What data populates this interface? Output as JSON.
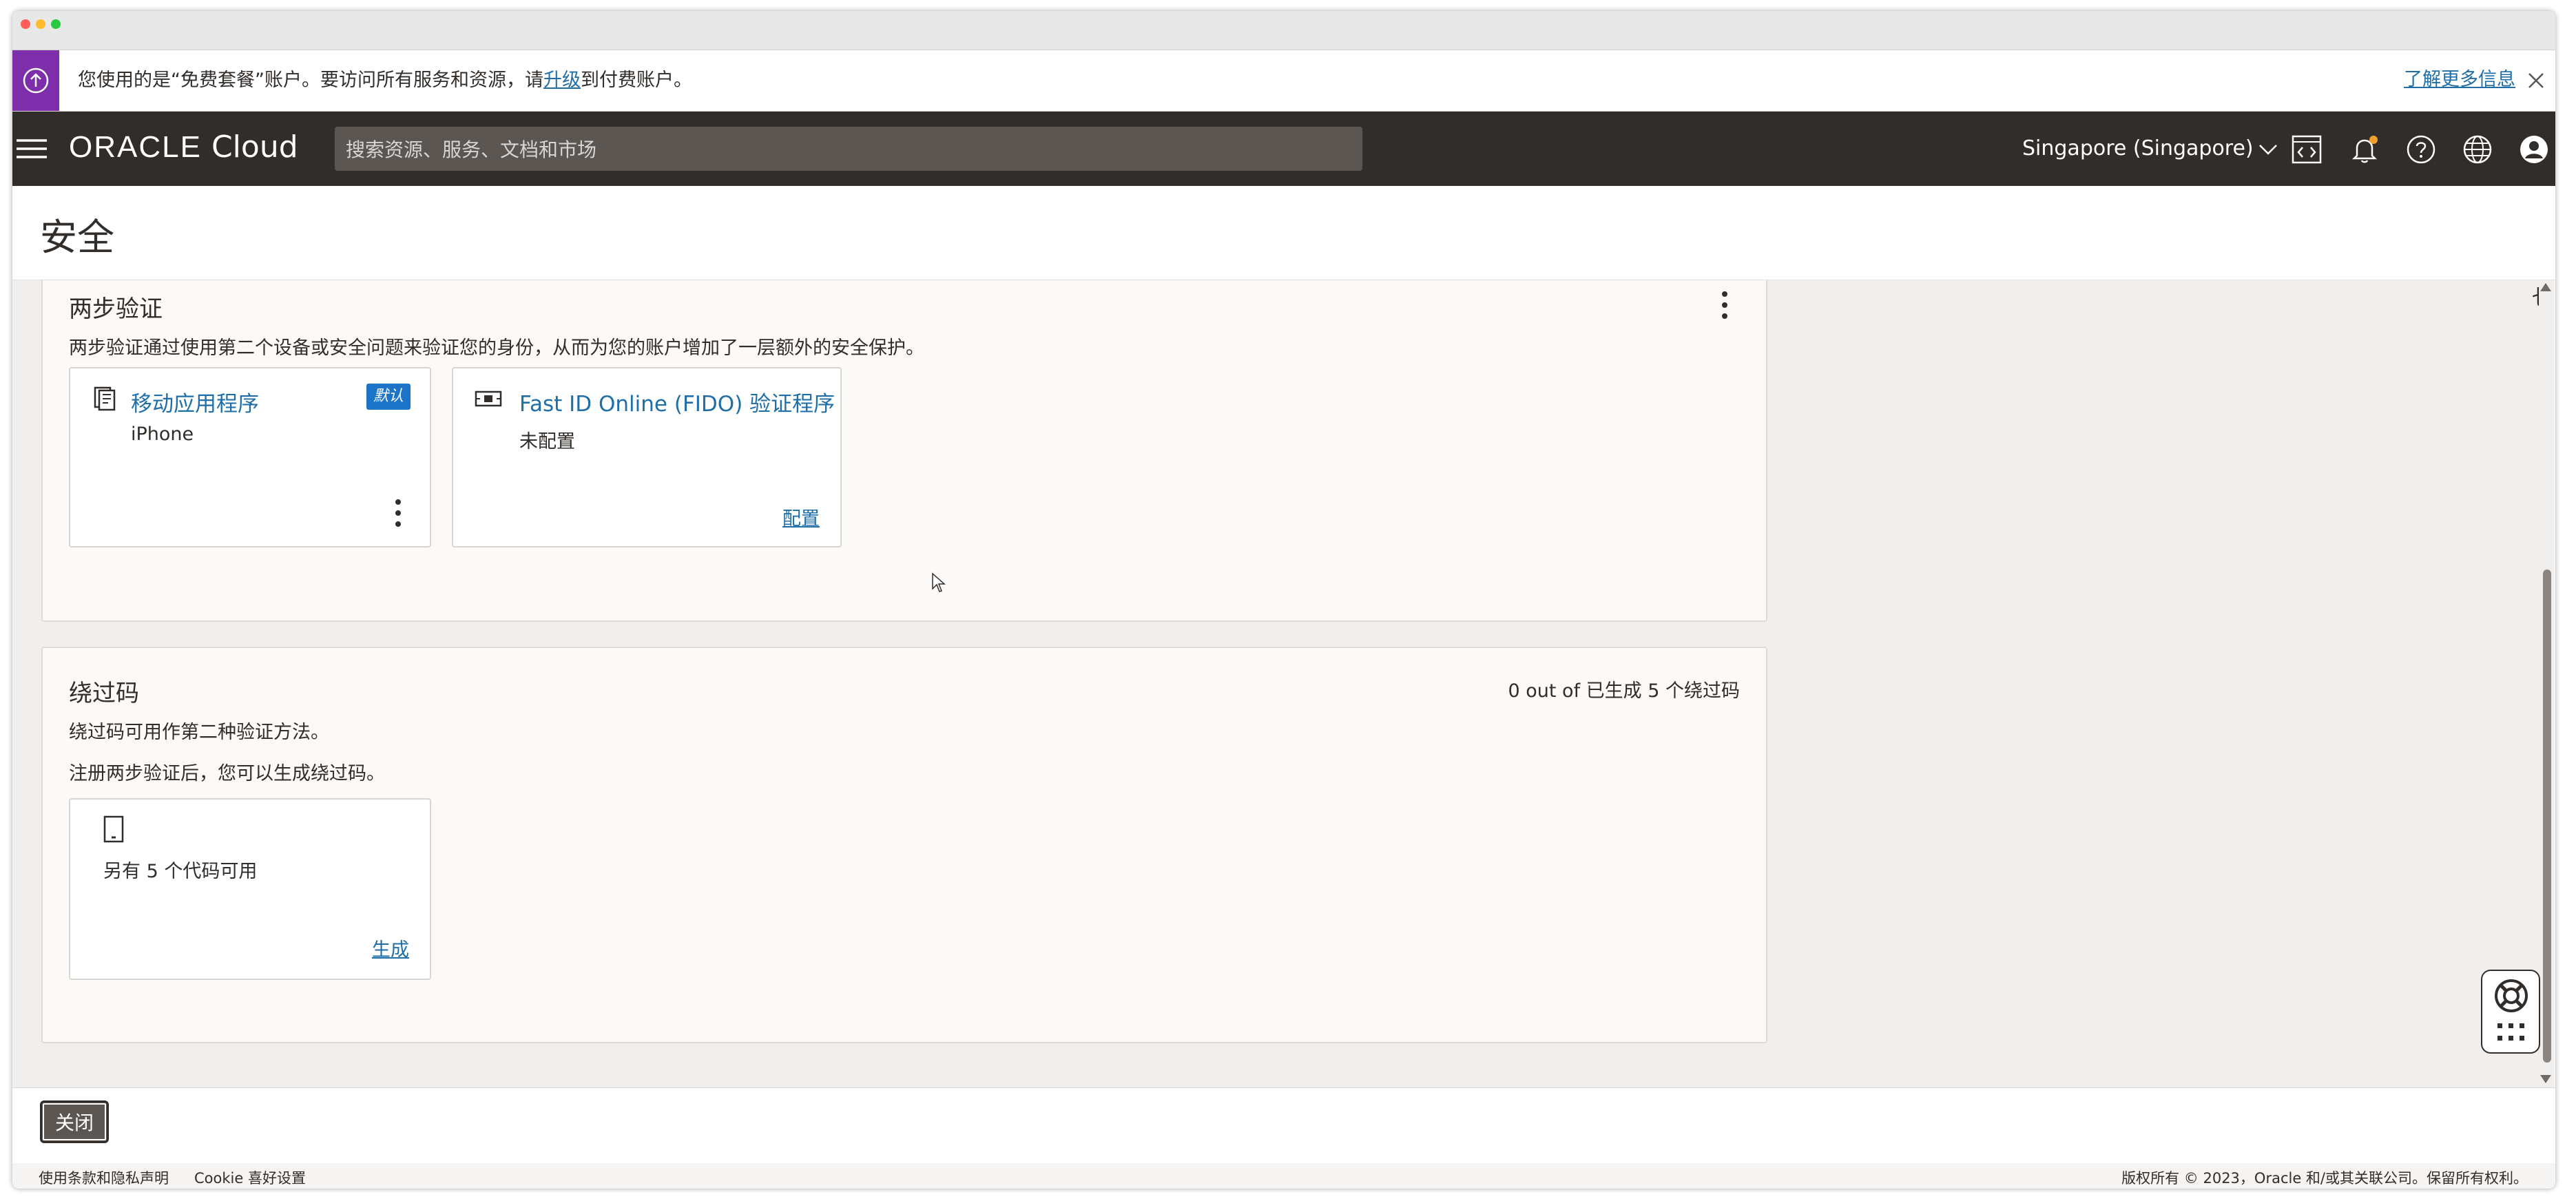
{
  "banner": {
    "text_before": "您使用的是“免费套餐”账户。要访问所有服务和资源，请",
    "upgrade_link": "升级",
    "text_after": "到付费账户。",
    "learn_more": "了解更多信息",
    "accent_color": "#7e2dab"
  },
  "navbar": {
    "logo_oracle": "ORACLE",
    "logo_cloud": "Cloud",
    "search_placeholder": "搜索资源、服务、文档和市场",
    "region": "Singapore (Singapore)",
    "icons": [
      "menu-icon",
      "code-editor-icon",
      "bell-icon",
      "help-icon",
      "globe-icon",
      "profile-icon"
    ]
  },
  "page": {
    "title": "安全",
    "edge_char": "乜"
  },
  "two_step": {
    "title": "两步验证",
    "description": "两步验证通过使用第二个设备或安全问题来验证您的身份，从而为您的账户增加了一层额外的安全保护。",
    "mobile_app": {
      "title": "移动应用程序",
      "badge": "默认",
      "device": "iPhone"
    },
    "fido": {
      "title": "Fast ID Online (FIDO) 验证程序",
      "status": "未配置",
      "action": "配置"
    }
  },
  "bypass": {
    "title": "绕过码",
    "counter": "0 out of 已生成 5 个绕过码",
    "description": "绕过码可用作第二种验证方法。",
    "note": "注册两步验证后，您可以生成绕过码。",
    "card": {
      "text": "另有 5 个代码可用",
      "action": "生成"
    }
  },
  "actions": {
    "close": "关闭"
  },
  "footer": {
    "terms": "使用条款和隐私声明",
    "cookie": "Cookie 喜好设置",
    "copyright": "版权所有 © 2023，Oracle 和/或其关联公司。保留所有权利。"
  }
}
